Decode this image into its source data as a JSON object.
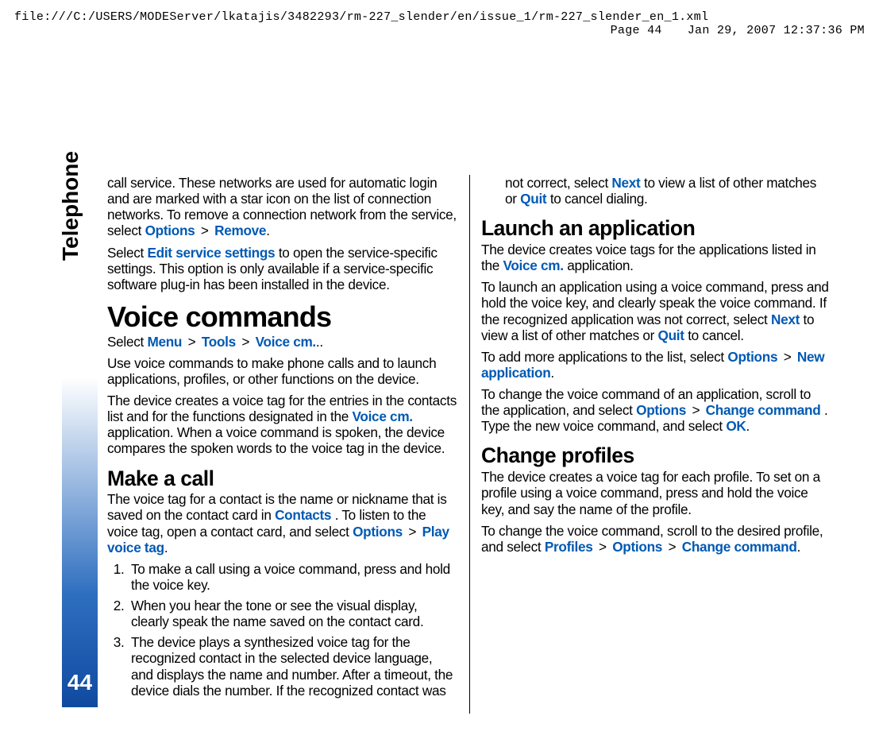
{
  "header": {
    "path": "file:///C:/USERS/MODEServer/lkatajis/3482293/rm-227_slender/en/issue_1/rm-227_slender_en_1.xml",
    "page": "Page 44",
    "date": "Jan 29, 2007 12:37:36 PM"
  },
  "sidebar": {
    "chapter": "Telephone",
    "page_number": "44"
  },
  "gt": ">",
  "ui": {
    "options": "Options",
    "remove": "Remove",
    "edit_service_settings": "Edit service settings",
    "menu": "Menu",
    "tools": "Tools",
    "voice_cm": "Voice cm.",
    "contacts": "Contacts",
    "play_voice_tag": "Play voice tag",
    "next": "Next",
    "quit": "Quit",
    "new_application": "New application",
    "change_command": "Change command",
    "ok": "OK",
    "profiles": "Profiles"
  },
  "body": {
    "call_svc_1": "call service. These networks are used for automatic login and are marked with a star icon on the list of connection networks. To remove a connection network from the service, select ",
    "period": ".",
    "edit_svc_1a": "Select ",
    "edit_svc_1b": " to open the service-specific settings. This option is only available if a service-specific software plug-in has been installed in the device.",
    "h_voice_commands": "Voice commands",
    "vc_select_a": "Select ",
    "vc_select_dotdot": "..",
    "vc_use": "Use voice commands to make phone calls and to launch applications, profiles, or other functions on the device.",
    "vc_tag_a": "The device creates a voice tag for the entries in the contacts list and for the functions designated in the ",
    "vc_tag_b": " application. When a voice command is spoken, the device compares the spoken words to the voice tag in the device.",
    "h_make_call": "Make a call",
    "mc_intro_a": "The voice tag for a contact is the name or nickname that is saved on the contact card in ",
    "mc_intro_b": ". To listen to the voice tag, open a contact card, and select ",
    "steps": {
      "s1": "To make a call using a voice command, press and hold the voice key.",
      "s2": "When you hear the tone or see the visual display, clearly speak the name saved on the contact card.",
      "s3a": "The device plays a synthesized voice tag for the recognized contact in the selected device language, and displays the name and number. After a timeout, the device dials the number. If the recognized contact was not correct, select ",
      "s3b": " to view a list of other matches or ",
      "s3c": " to cancel dialing."
    },
    "h_launch_app": "Launch an application",
    "la_intro_a": "The device creates voice tags for the applications listed in the ",
    "la_intro_b": " application.",
    "la_launch_a": "To launch an application using a voice command, press and hold the voice key, and clearly speak the voice command. If the recognized application was not correct, select ",
    "la_launch_b": " to view a list of other matches or ",
    "la_launch_c": " to cancel.",
    "la_add_a": "To add more applications to the list, select ",
    "la_chg_a": "To change the voice command of an application, scroll to the application, and select ",
    "la_chg_b": ". Type the new voice command, and select ",
    "h_change_profiles": "Change profiles",
    "cp_intro": "The device creates a voice tag for each profile. To set on a profile using a voice command, press and hold the voice key, and say the name of the profile.",
    "cp_chg_a": "To change the voice command, scroll to the desired profile, and select "
  }
}
